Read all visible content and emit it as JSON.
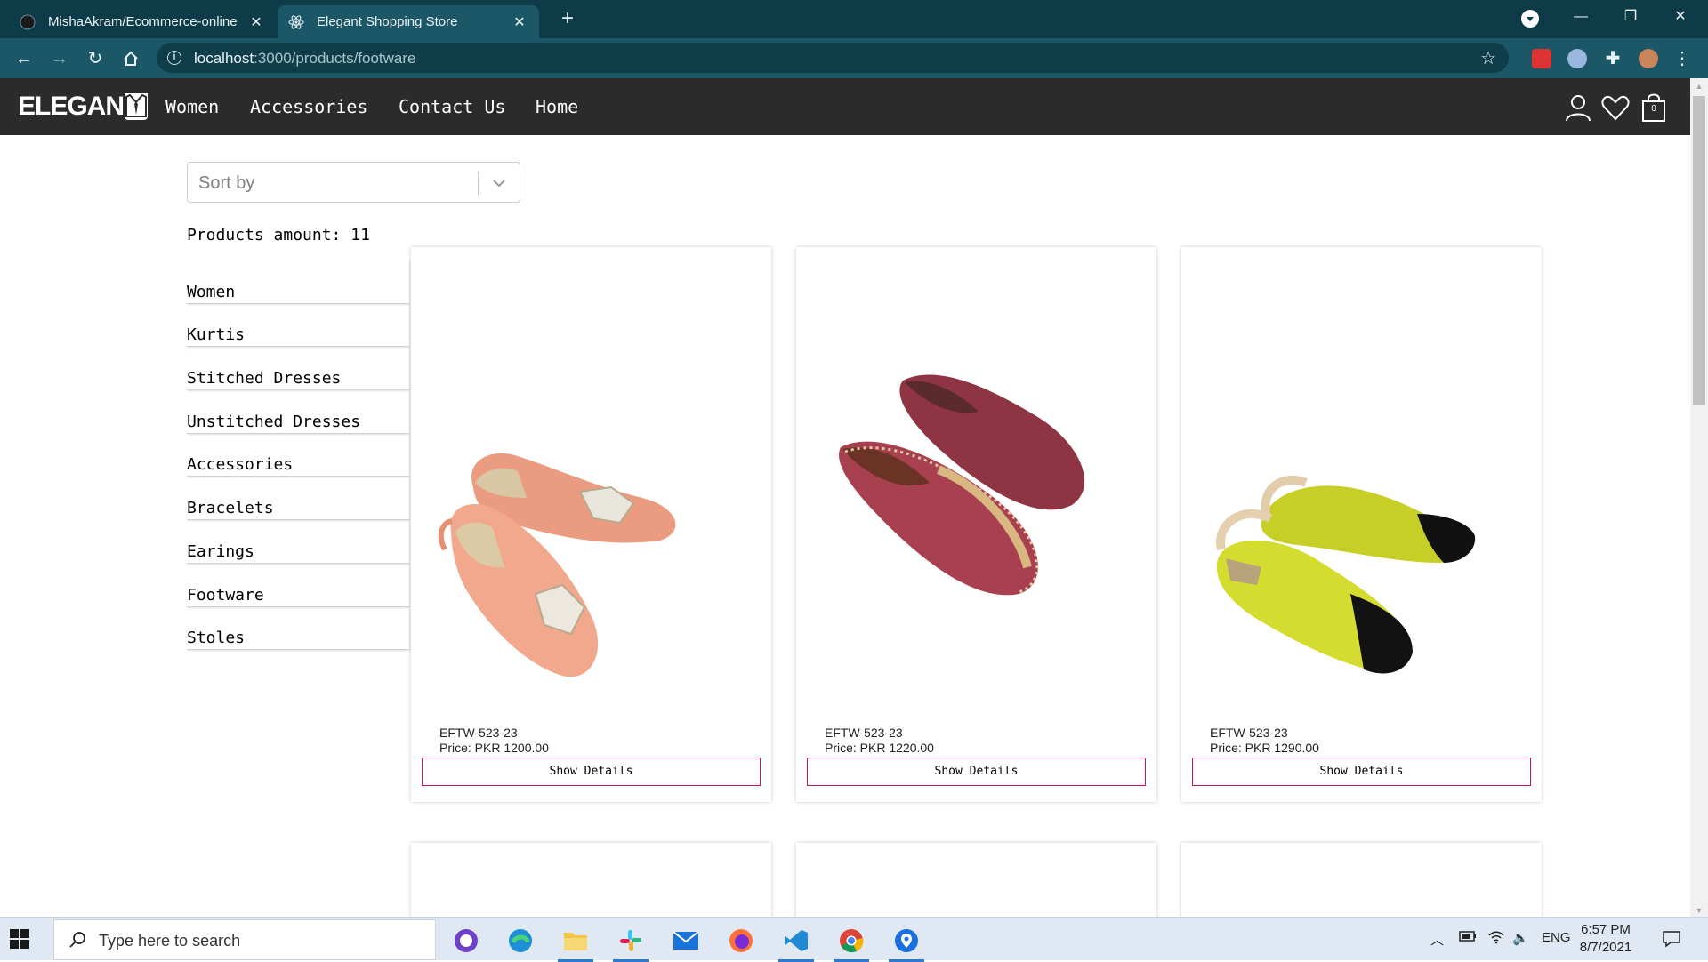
{
  "browser": {
    "tabs": [
      {
        "title": "MishaAkram/Ecommerce-online",
        "active": false
      },
      {
        "title": "Elegant Shopping Store",
        "active": true
      }
    ],
    "url_host": "localhost",
    "url_path": ":3000/products/footware"
  },
  "site": {
    "logo_text": "ELEGAN",
    "nav": [
      "Women",
      "Accessories",
      "Contact Us",
      "Home"
    ],
    "cart_count": "0"
  },
  "sort": {
    "placeholder": "Sort by"
  },
  "products_amount": "Products amount: 11",
  "categories": [
    "Women",
    "Kurtis",
    "Stitched Dresses",
    "Unstitched Dresses",
    "Accessories",
    "Bracelets",
    "Earings",
    "Footware",
    "Stoles"
  ],
  "products": [
    {
      "code": "EFTW-523-23",
      "price": "Price: PKR 1200.00",
      "button": "Show Details"
    },
    {
      "code": "EFTW-523-23",
      "price": "Price: PKR 1220.00",
      "button": "Show Details"
    },
    {
      "code": "EFTW-523-23",
      "price": "Price: PKR 1290.00",
      "button": "Show Details"
    }
  ],
  "taskbar": {
    "search_placeholder": "Type here to search",
    "language": "ENG",
    "time": "6:57 PM",
    "date": "8/7/2021"
  },
  "colors": {
    "tabbar": "#0d3b47",
    "toolbar": "#1b5766",
    "site_header": "#2b2b2b",
    "button_border": "#c2185b"
  }
}
